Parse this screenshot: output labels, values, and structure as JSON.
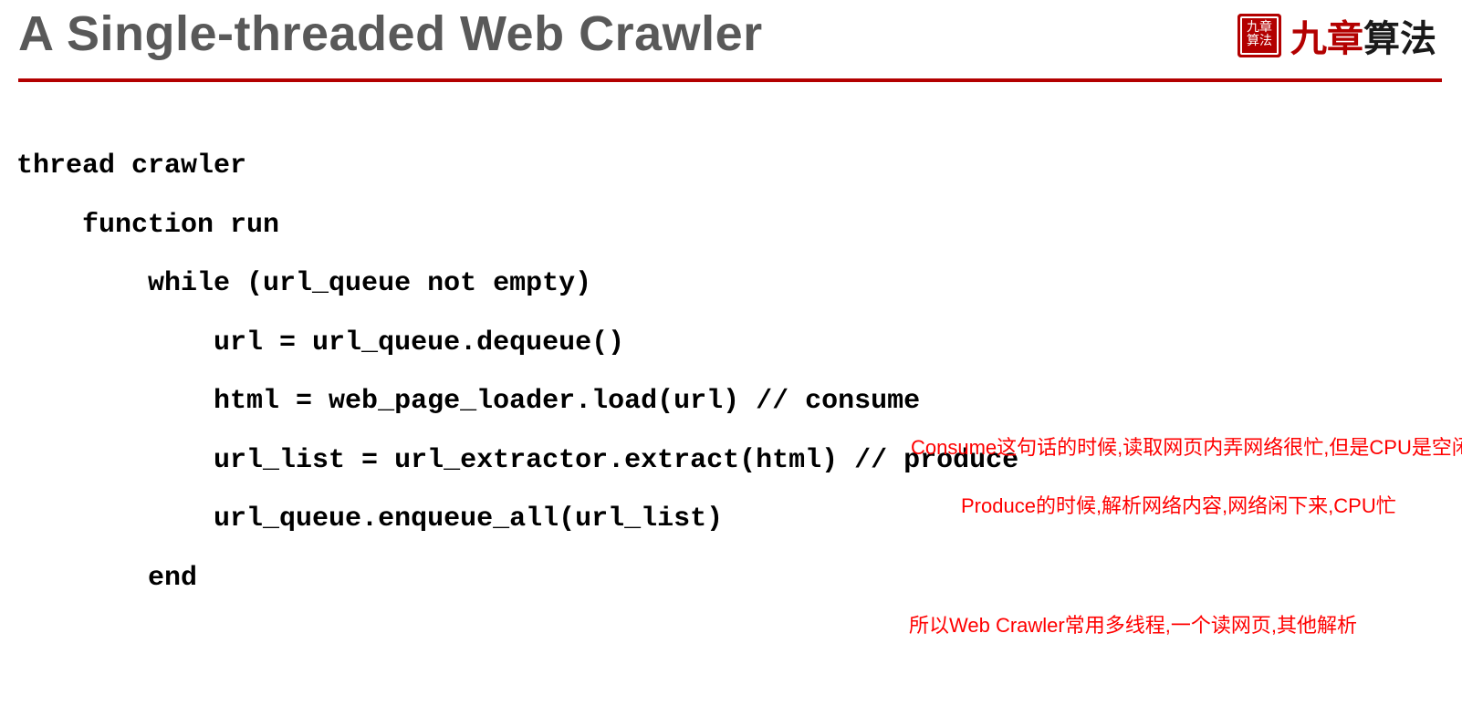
{
  "header": {
    "title": "A Single-threaded Web Crawler"
  },
  "logo": {
    "seal_text": "九章算法",
    "brand_red": "九章",
    "brand_black": "算法"
  },
  "code": {
    "l1": "thread crawler",
    "l2": "    function run",
    "l3": "        while (url_queue not empty)",
    "l4": "            url = url_queue.dequeue()",
    "l5": "            html = web_page_loader.load(url) // consume",
    "l6": "            url_list = url_extractor.extract(html) // produce",
    "l7": "            url_queue.enqueue_all(url_list)",
    "l8": "        end"
  },
  "annotations": {
    "a1": "Consume这句话的时候,读取网页内弄网络很忙,但是CPU是空闲的",
    "a2": "Produce的时候,解析网络内容,网络闲下来,CPU忙",
    "a3": "所以Web Crawler常用多线程,一个读网页,其他解析"
  }
}
